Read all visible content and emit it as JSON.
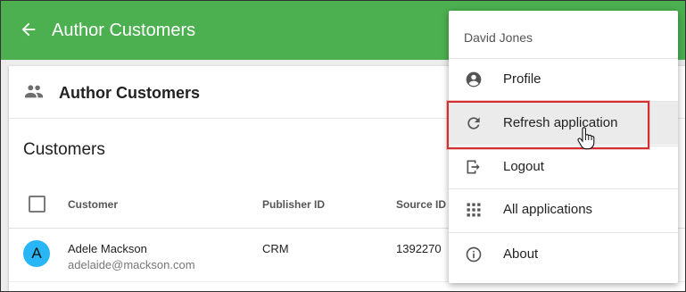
{
  "appbar": {
    "title": "Author Customers",
    "back_icon": "arrow-left-icon"
  },
  "card": {
    "heading": "Author Customers",
    "heading_icon": "people-icon",
    "section_title": "Customers",
    "table": {
      "columns": [
        "Customer",
        "Publisher ID",
        "Source ID"
      ],
      "rows": [
        {
          "avatar": "A",
          "name": "Adele Mackson",
          "email": "adelaide@mackson.com",
          "publisher_id": "CRM",
          "source_id": "1392270"
        }
      ]
    }
  },
  "menu": {
    "user_name": "David Jones",
    "items": [
      {
        "label": "Profile",
        "icon": "account-circle-icon"
      },
      {
        "label": "Refresh application",
        "icon": "refresh-icon"
      },
      {
        "label": "Logout",
        "icon": "logout-icon"
      },
      {
        "label": "All applications",
        "icon": "apps-grid-icon"
      },
      {
        "label": "About",
        "icon": "info-icon"
      }
    ]
  },
  "colors": {
    "appbar": "#4caf50",
    "avatar": "#29b6f6",
    "highlight": "#d32f2f"
  }
}
